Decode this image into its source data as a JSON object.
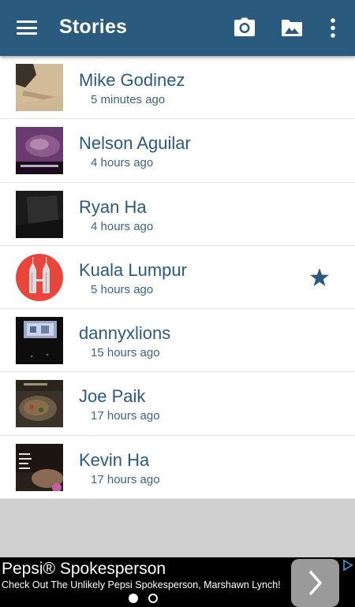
{
  "appbar": {
    "title": "Stories",
    "background": "#2a5b7e",
    "icons": [
      "menu-icon",
      "camera-icon",
      "folder-image-icon",
      "more-vertical-icon"
    ]
  },
  "stories": [
    {
      "name": "Mike Godinez",
      "time": "5 minutes ago",
      "favorite": false
    },
    {
      "name": "Nelson Aguilar",
      "time": "4 hours ago",
      "favorite": false
    },
    {
      "name": "Ryan Ha",
      "time": "4 hours ago",
      "favorite": false
    },
    {
      "name": "Kuala Lumpur",
      "time": "5 hours ago",
      "favorite": true
    },
    {
      "name": "dannyxlions",
      "time": "15 hours ago",
      "favorite": false
    },
    {
      "name": "Joe Paik",
      "time": "17 hours ago",
      "favorite": false
    },
    {
      "name": "Kevin Ha",
      "time": "17 hours ago",
      "favorite": false
    }
  ],
  "ad": {
    "title": "Pepsi® Spokesperson",
    "subtitle": "Check Out The Unlikely Pepsi Spokesperson, Marshawn Lynch!",
    "page_count": 2,
    "active_page": 1
  },
  "colors": {
    "accent": "#2a5b7e",
    "star": "#2a5b7e",
    "ad_background": "#000000"
  }
}
